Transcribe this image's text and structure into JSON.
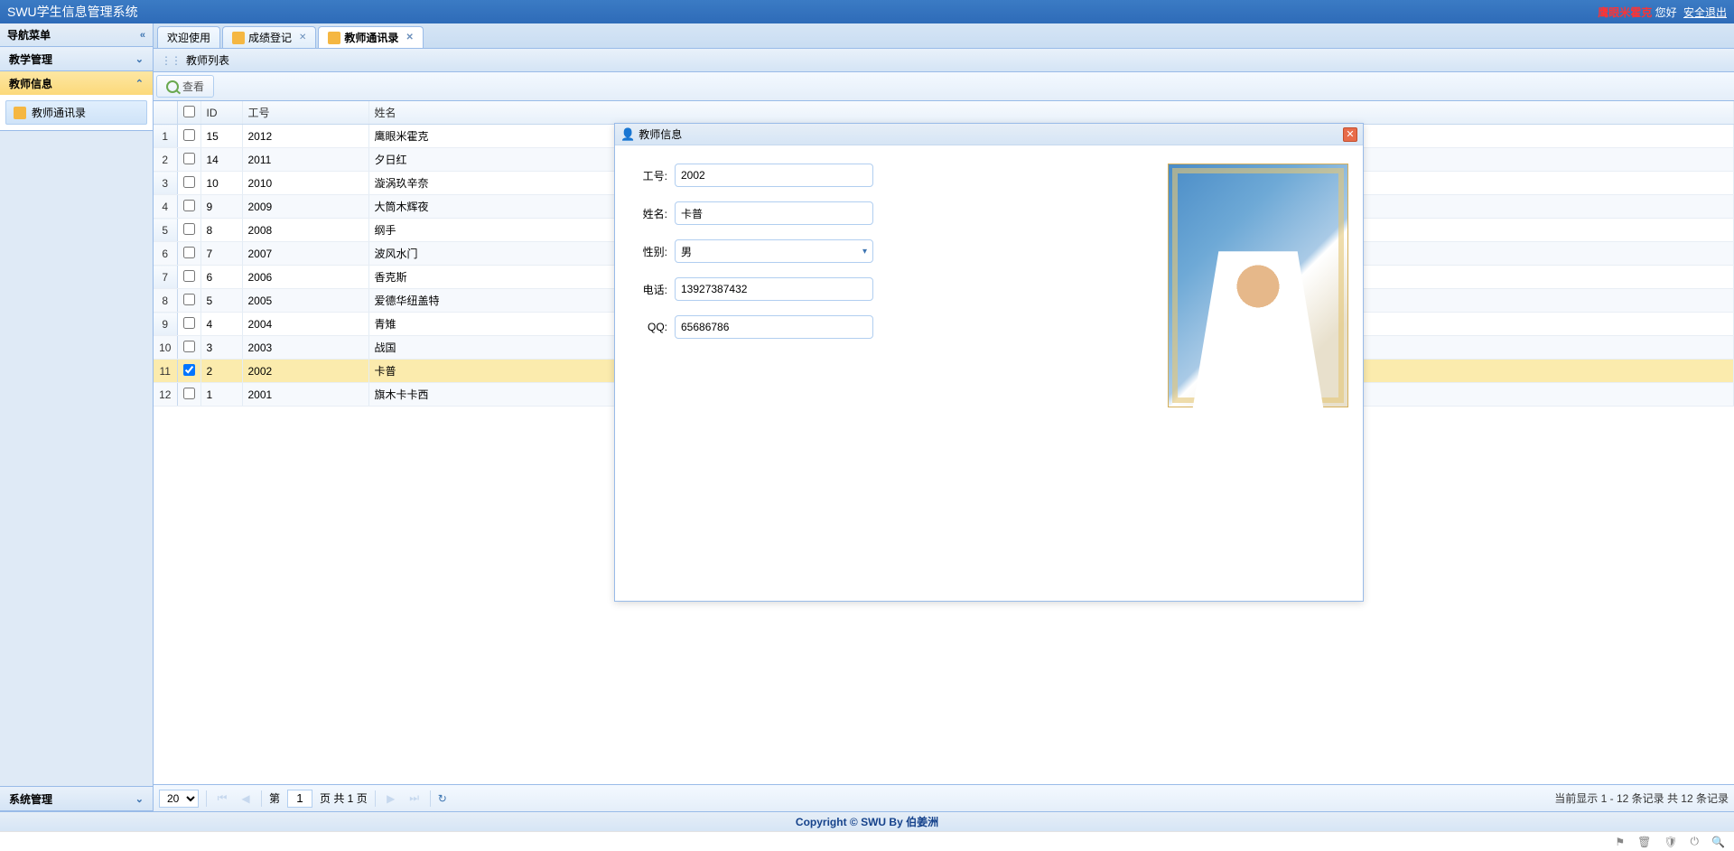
{
  "header": {
    "title": "SWU学生信息管理系统",
    "username": "鹰眼米霍克",
    "greeting": "您好",
    "logout": "安全退出"
  },
  "sidebar": {
    "title": "导航菜单",
    "sections": [
      {
        "label": "教学管理",
        "expanded": false
      },
      {
        "label": "教师信息",
        "expanded": true,
        "items": [
          {
            "label": "教师通讯录"
          }
        ]
      },
      {
        "label": "系统管理",
        "expanded": false,
        "position": "bottom"
      }
    ]
  },
  "tabs": [
    {
      "label": "欢迎使用",
      "closable": false,
      "active": false,
      "icon": null
    },
    {
      "label": "成绩登记",
      "closable": true,
      "active": false,
      "icon": "pencil"
    },
    {
      "label": "教师通讯录",
      "closable": true,
      "active": true,
      "icon": "card"
    }
  ],
  "panel": {
    "title": "教师列表",
    "toolbar": {
      "view_label": "查看"
    }
  },
  "columns": {
    "id": "ID",
    "number": "工号",
    "name": "姓名"
  },
  "rows": [
    {
      "idx": 1,
      "checked": false,
      "id": "15",
      "number": "2012",
      "name": "鹰眼米霍克"
    },
    {
      "idx": 2,
      "checked": false,
      "id": "14",
      "number": "2011",
      "name": "夕日红"
    },
    {
      "idx": 3,
      "checked": false,
      "id": "10",
      "number": "2010",
      "name": "漩涡玖辛奈"
    },
    {
      "idx": 4,
      "checked": false,
      "id": "9",
      "number": "2009",
      "name": "大筒木辉夜"
    },
    {
      "idx": 5,
      "checked": false,
      "id": "8",
      "number": "2008",
      "name": "纲手"
    },
    {
      "idx": 6,
      "checked": false,
      "id": "7",
      "number": "2007",
      "name": "波风水门"
    },
    {
      "idx": 7,
      "checked": false,
      "id": "6",
      "number": "2006",
      "name": "香克斯"
    },
    {
      "idx": 8,
      "checked": false,
      "id": "5",
      "number": "2005",
      "name": "爱德华纽盖特"
    },
    {
      "idx": 9,
      "checked": false,
      "id": "4",
      "number": "2004",
      "name": "青雉"
    },
    {
      "idx": 10,
      "checked": false,
      "id": "3",
      "number": "2003",
      "name": "战国"
    },
    {
      "idx": 11,
      "checked": true,
      "id": "2",
      "number": "2002",
      "name": "卡普"
    },
    {
      "idx": 12,
      "checked": false,
      "id": "1",
      "number": "2001",
      "name": "旗木卡卡西"
    }
  ],
  "dialog": {
    "title": "教师信息",
    "fields": {
      "number_label": "工号:",
      "number_value": "2002",
      "name_label": "姓名:",
      "name_value": "卡普",
      "gender_label": "性别:",
      "gender_value": "男",
      "phone_label": "电话:",
      "phone_value": "13927387432",
      "qq_label": "QQ:",
      "qq_value": "65686786"
    }
  },
  "pager": {
    "page_size": "20",
    "prefix": "第",
    "page": "1",
    "total_pages_text": "页 共 1 页",
    "display": "当前显示 1 - 12 条记录 共 12 条记录"
  },
  "footer": "Copyright © SWU By 伯姜洲"
}
